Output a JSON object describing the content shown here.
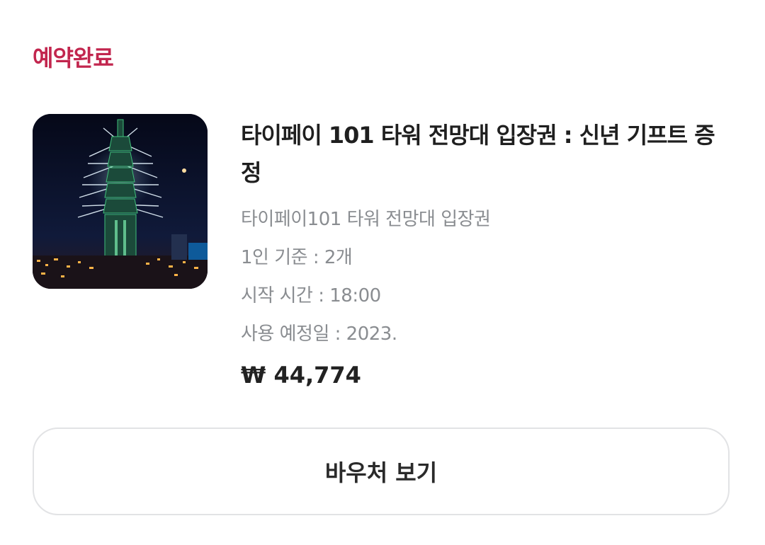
{
  "reservation": {
    "status_label": "예약완료",
    "status_color": "#c2264e"
  },
  "product": {
    "image_icon": "taipei-101-fireworks-photo",
    "title": "타이페이 101 타워 전망대 입장권 : 신년 기프트 증정",
    "option_name": "타이페이101 타워 전망대 입장권",
    "quantity_text": "1인 기준 : 2개",
    "start_time_text": "시작 시간 : 18:00",
    "use_date_text": "사용 예정일 : 2023.",
    "price_text": "₩ 44,774"
  },
  "actions": {
    "voucher_button_label": "바우처 보기"
  }
}
